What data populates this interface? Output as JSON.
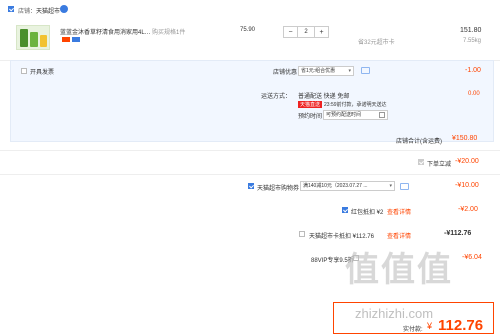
{
  "shop": {
    "label": "店铺：",
    "name": "天猫超市"
  },
  "item": {
    "title": "蓝蓝金沐香草籽清食用消家用4L…",
    "spec_label": "购买规格：",
    "spec_value": "1件",
    "unit_price": "75.90",
    "qty": "2",
    "minus": "−",
    "plus": "+",
    "discount_note": "省32元超市卡",
    "subtotal": "151.80",
    "weight": "7.55kg"
  },
  "invoice": {
    "label": "开具发票"
  },
  "coupon": {
    "label": "店铺优惠：",
    "selected": "省1元:组合优惠",
    "amount": "-1.00"
  },
  "shipping": {
    "label": "运送方式：",
    "method": "普通配送 快递 免邮",
    "amount": "0.00",
    "badge": "天猫直送",
    "delivery_note": "23:59前付款，承诺明天送达",
    "time_label": "预约时间：",
    "time_placeholder": "可预约配送时间"
  },
  "store_total": {
    "label": "店铺合计(含运费)",
    "amount": "¥150.80"
  },
  "lines": {
    "order_discount": {
      "label": "下单立减",
      "amount": "-¥20.00"
    },
    "tmall_coupon": {
      "label": "天猫超市购物券",
      "selected": "满140减10元（2023.07.27 ...",
      "amount": "-¥10.00"
    },
    "red_packet": {
      "label": "红包抵扣 ¥2",
      "link": "查看详情",
      "amount": "-¥2.00"
    },
    "market_card": {
      "label": "天猫超市卡抵扣 ¥112.76",
      "link": "查看详情",
      "amount": "-¥112.76"
    },
    "vip": {
      "label": "88VIP专享9.5折",
      "amount": "-¥6.04"
    }
  },
  "pay": {
    "label": "实付款:",
    "currency": "¥",
    "amount": "112.76"
  },
  "watermark": {
    "text": "值值值",
    "sub": "zhizhizhi.com"
  },
  "colors": {
    "accent": "#ff4400",
    "blue": "#3a7be0"
  }
}
